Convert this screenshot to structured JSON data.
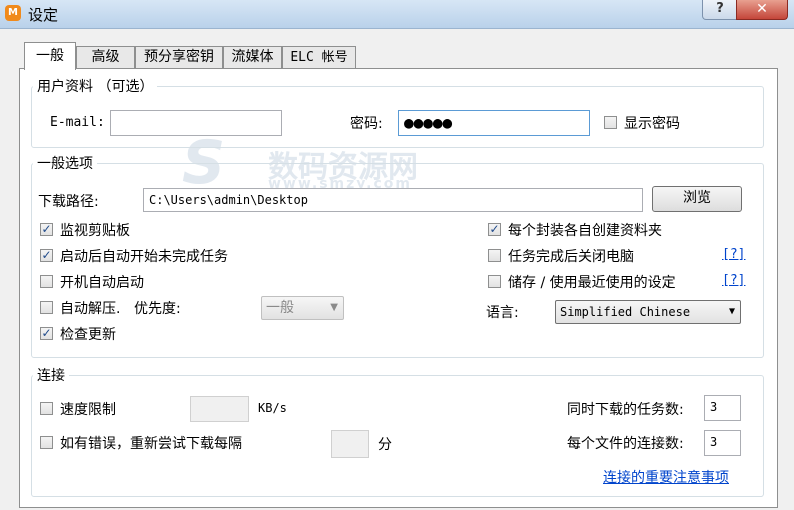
{
  "window": {
    "title": "设定",
    "app_icon_glyph": "M",
    "help_glyph": "?",
    "close_glyph": "✕"
  },
  "tabs": [
    {
      "label": "一般",
      "active": true
    },
    {
      "label": "高级",
      "active": false
    },
    {
      "label": "预分享密钥",
      "active": false
    },
    {
      "label": "流媒体",
      "active": false
    },
    {
      "label": "ELC 帐号",
      "active": false
    }
  ],
  "user_info": {
    "legend": "用户资料 （可选）",
    "email_label": "E-mail:",
    "email_value": "",
    "password_label": "密码:",
    "password_value": "●●●●●",
    "show_password_label": "显示密码",
    "show_password_checked": false
  },
  "general": {
    "legend": "一般选项",
    "download_path_label": "下载路径:",
    "download_path_value": "C:\\Users\\admin\\Desktop",
    "browse_label": "浏览",
    "monitor_clipboard": {
      "label": "监视剪贴板",
      "checked": true
    },
    "auto_start": {
      "label": "启动后自动开始未完成任务",
      "checked": true
    },
    "run_at_boot": {
      "label": "开机自动启动",
      "checked": false
    },
    "auto_extract": {
      "label": "自动解压.",
      "checked": false
    },
    "priority_label": "优先度:",
    "priority_value": "一般",
    "check_updates": {
      "label": "检查更新",
      "checked": true
    },
    "folder_per_pack": {
      "label": "每个封装各自创建资料夹",
      "checked": true
    },
    "shutdown_after": {
      "label": "任务完成后关闭电脑",
      "checked": false,
      "help": "[?]"
    },
    "save_last_settings": {
      "label": "储存 / 使用最近使用的设定",
      "checked": false,
      "help": "[?]"
    },
    "language_label": "语言:",
    "language_value": "Simplified Chinese"
  },
  "connection": {
    "legend": "连接",
    "speed_limit": {
      "label": "速度限制",
      "checked": false,
      "value": "",
      "unit": "KB/s"
    },
    "retry": {
      "label": "如有错误，重新尝试下载每隔",
      "checked": false,
      "value": "",
      "unit": "分"
    },
    "simultaneous_label": "同时下载的任务数:",
    "simultaneous_value": "3",
    "connections_label": "每个文件的连接数:",
    "connections_value": "3",
    "notes_link": "连接的重要注意事项"
  },
  "watermark": {
    "brand": "数码资源网",
    "url": "www.smzy.com"
  },
  "icons": {
    "check": "✓",
    "dropdown": "▼"
  }
}
